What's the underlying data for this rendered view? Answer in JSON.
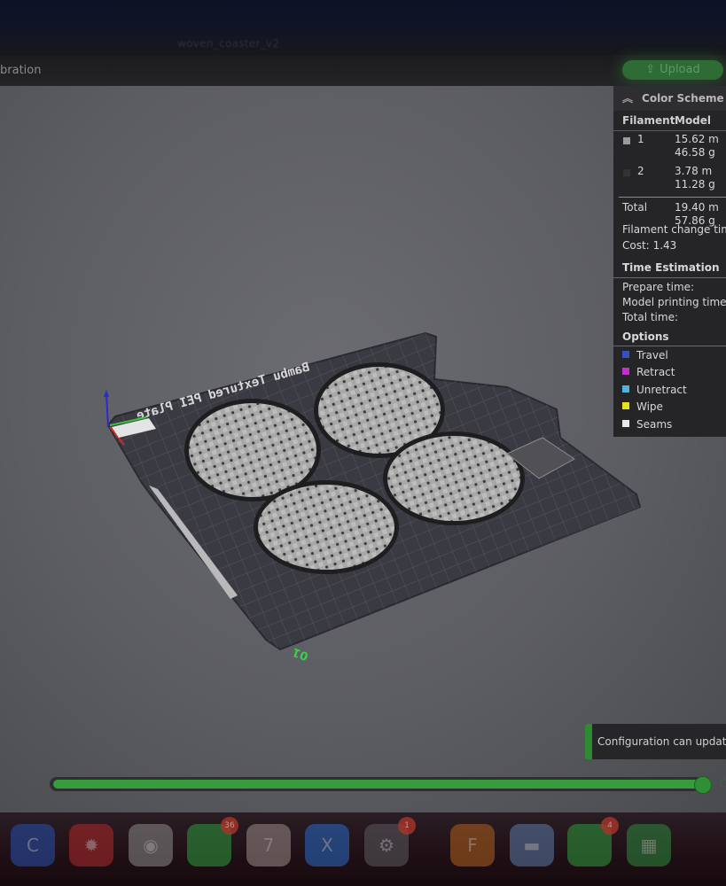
{
  "window": {
    "title": "woven_coaster_v2"
  },
  "toolbar": {
    "partial_item": "bration",
    "upload_label": "Upload",
    "upload_icon": "upload-icon"
  },
  "legend": {
    "header": "Color Scheme",
    "columns": [
      "Filament",
      "Model"
    ],
    "filaments": [
      {
        "id": "1",
        "color": "#9a9a9a",
        "length": "15.62 m",
        "weight": "46.58 g"
      },
      {
        "id": "2",
        "color": "#333335",
        "length": "3.78 m",
        "weight": "11.28 g"
      }
    ],
    "total": {
      "label": "Total",
      "length": "19.40 m",
      "weight": "57.86 g"
    },
    "filament_change_label": "Filament change times",
    "cost_label": "Cost:",
    "cost_value": "1.43",
    "time_section": "Time Estimation",
    "prepare_label": "Prepare time:",
    "model_print_label": "Model printing time:",
    "total_time_label": "Total time:",
    "options_section": "Options",
    "options": [
      {
        "label": "Travel",
        "color": "#3a4fc0"
      },
      {
        "label": "Retract",
        "color": "#c22ed0"
      },
      {
        "label": "Unretract",
        "color": "#4fb3dc"
      },
      {
        "label": "Wipe",
        "color": "#e6e21a"
      },
      {
        "label": "Seams",
        "color": "#e8e8e8"
      }
    ]
  },
  "viewport": {
    "plate_label": "Bambu Textured PEI Plate",
    "plate_number": "01",
    "object_count": 4
  },
  "notification": {
    "text": "Configuration can update now."
  },
  "layer_slider": {
    "value_fraction": 1.0
  },
  "dock": {
    "apps": [
      {
        "name": "app-c",
        "glyph": "C",
        "color": "#2a4fb0",
        "badge": ""
      },
      {
        "name": "app-red",
        "glyph": "✹",
        "color": "#b02a2a",
        "badge": ""
      },
      {
        "name": "chrome",
        "glyph": "◉",
        "color": "#8a8a8a",
        "badge": ""
      },
      {
        "name": "messages",
        "glyph": "",
        "color": "#2e9a3e",
        "badge": "36"
      },
      {
        "name": "calendar",
        "glyph": "7",
        "color": "#9a8a8a",
        "badge": ""
      },
      {
        "name": "xcode",
        "glyph": "X",
        "color": "#2a6ac8",
        "badge": ""
      },
      {
        "name": "settings",
        "glyph": "⚙",
        "color": "#5a5a60",
        "badge": "1"
      },
      {
        "name": "app-orange",
        "glyph": "F",
        "color": "#b0601e",
        "badge": ""
      },
      {
        "name": "preview",
        "glyph": "▬",
        "color": "#5a7aa8",
        "badge": ""
      },
      {
        "name": "facetime",
        "glyph": "",
        "color": "#2e9a3e",
        "badge": "4"
      },
      {
        "name": "numbers",
        "glyph": "▦",
        "color": "#2e8a3e",
        "badge": ""
      }
    ]
  }
}
